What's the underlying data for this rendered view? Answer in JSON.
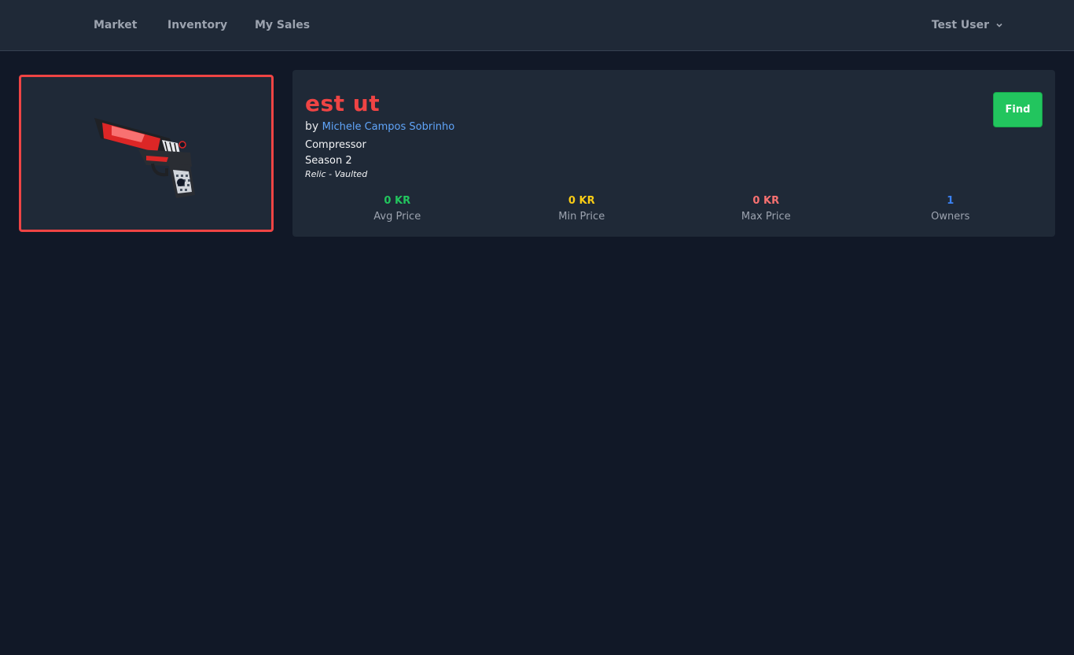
{
  "nav": {
    "links": [
      "Market",
      "Inventory",
      "My Sales"
    ],
    "user": "Test User"
  },
  "item": {
    "image_icon": "pistol-icon",
    "title": "est ut",
    "by_prefix": "by",
    "author": "Michele Campos Sobrinho",
    "type": "Compressor",
    "season": "Season 2",
    "rarity": "Relic - Vaulted",
    "find_label": "Find",
    "highlight_color": "#ef4444"
  },
  "stats": [
    {
      "value": "0 KR",
      "label": "Avg Price",
      "color": "#22c55e"
    },
    {
      "value": "0 KR",
      "label": "Min Price",
      "color": "#facc15"
    },
    {
      "value": "0 KR",
      "label": "Max Price",
      "color": "#f87171"
    },
    {
      "value": "1",
      "label": "Owners",
      "color": "#3b82f6"
    }
  ]
}
